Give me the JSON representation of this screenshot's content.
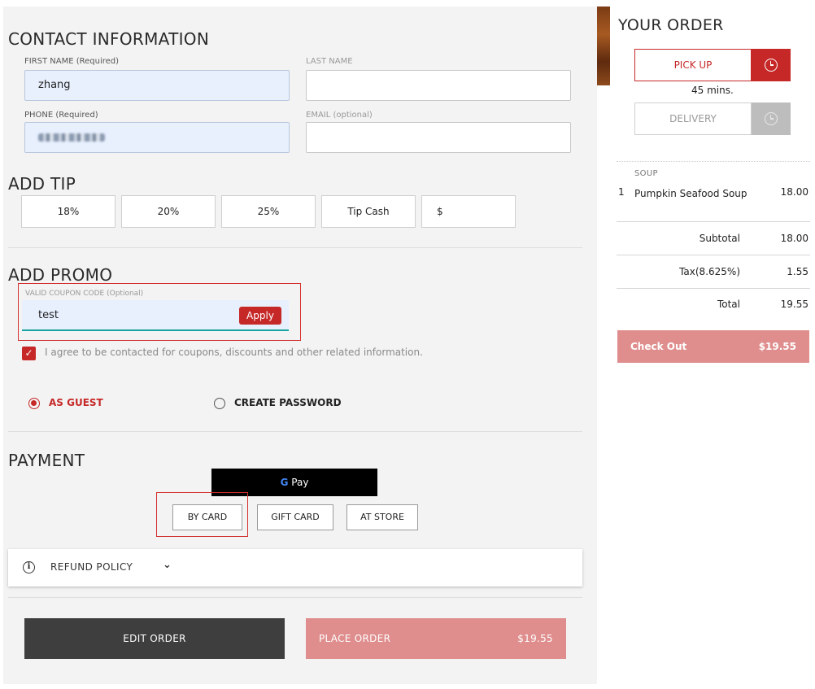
{
  "contact": {
    "title": "CONTACT INFORMATION",
    "first_name_label": "FIRST NAME (Required)",
    "first_name_value": "zhang",
    "last_name_label": "LAST NAME",
    "last_name_value": "",
    "phone_label": "PHONE (Required)",
    "email_label": "EMAIL (optional)",
    "email_value": ""
  },
  "tip": {
    "title": "ADD TIP",
    "options": [
      "18%",
      "20%",
      "25%",
      "Tip Cash"
    ],
    "custom_placeholder": "$"
  },
  "promo": {
    "title": "ADD PROMO",
    "label": "VALID COUPON CODE (Optional)",
    "value": "test",
    "apply_label": "Apply",
    "agree_text": "I agree to be contacted for coupons, discounts and other related information.",
    "agree_checked": true
  },
  "account": {
    "guest_label": "AS GUEST",
    "create_password_label": "CREATE PASSWORD",
    "selected": "guest"
  },
  "payment": {
    "title": "PAYMENT",
    "gpay_g": "G",
    "gpay_label": "Pay",
    "methods": [
      "BY CARD",
      "GIFT CARD",
      "AT STORE"
    ]
  },
  "refund": {
    "label": "REFUND POLICY",
    "info_glyph": "i",
    "chevron": "⌄"
  },
  "actions": {
    "edit_label": "EDIT ORDER",
    "place_label": "PLACE ORDER",
    "place_total": "$19.55"
  },
  "order": {
    "title": "YOUR ORDER",
    "pickup_label": "PICK UP",
    "pickup_time": "45 mins.",
    "delivery_label": "DELIVERY",
    "category": "SOUP",
    "items": [
      {
        "qty": "1",
        "name": "Pumpkin Seafood Soup",
        "price": "18.00"
      }
    ],
    "subtotal_label": "Subtotal",
    "subtotal": "18.00",
    "tax_label": "Tax(8.625%)",
    "tax": "1.55",
    "total_label": "Total",
    "total": "19.55",
    "checkout_label": "Check Out",
    "checkout_total": "$19.55"
  },
  "colors": {
    "accent": "#c62828",
    "accent_light": "#df8d8d",
    "dark_button": "#3e3e3e",
    "autofill": "#e8f0fe"
  }
}
